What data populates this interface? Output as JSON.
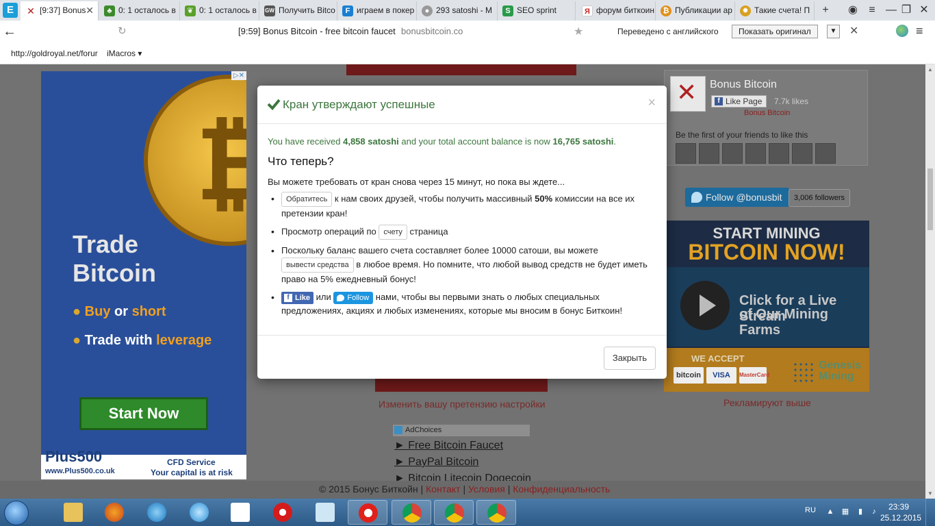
{
  "browser": {
    "tabs": [
      {
        "label": "[9:37] Bonus",
        "icon_color": "#ffffff",
        "icon": "bonus-bitcoin-icon",
        "active": true
      },
      {
        "label": "0: 1 осталось в",
        "icon_color": "#3c8a2a",
        "icon": "tree-icon"
      },
      {
        "label": "0: 1 осталось в",
        "icon_color": "#5aa02a",
        "icon": "leaf-icon"
      },
      {
        "label": "Получить Bitco",
        "icon_color": "#555555",
        "icon": "gw-icon"
      },
      {
        "label": "играем в покер",
        "icon_color": "#1a7fd0",
        "icon": "f-icon"
      },
      {
        "label": "293 satoshi - M",
        "icon_color": "#999999",
        "icon": "coin-icon"
      },
      {
        "label": "SEO sprint",
        "icon_color": "#2a9a4a",
        "icon": "seo-icon"
      },
      {
        "label": "форум биткоин",
        "icon_color": "#cc2a2a",
        "icon": "yandex-icon"
      },
      {
        "label": "Публикации ар",
        "icon_color": "#e0901a",
        "icon": "bitcoin-icon"
      },
      {
        "label": "Такие счета! П",
        "icon_color": "#d9a020",
        "icon": "gear-icon"
      }
    ],
    "new_tab": "+",
    "address": {
      "title": "[9:59] Bonus Bitcoin - free bitcoin faucet",
      "domain": "bonusbitcoin.co"
    },
    "translate": {
      "label": "Переведено с английского",
      "show_original": "Показать оригинал"
    },
    "bookmarks": [
      {
        "label": "http://goldroyal.net/forur"
      },
      {
        "label": "iMacros ▾"
      }
    ]
  },
  "left_ad": {
    "corner": "▷✕",
    "title_line1": "Trade",
    "title_line2": "Bitcoin",
    "bullet1_a": "Buy",
    "bullet1_b": "or",
    "bullet1_c": "short",
    "bullet2_a": "Trade with",
    "bullet2_b": "leverage",
    "cta": "Start Now",
    "brand": "Plus500",
    "brand_url": "www.Plus500.co.uk",
    "cfd": "CFD Service",
    "risk": "Your capital is at risk"
  },
  "center": {
    "change_link": "Изменить вашу претензию настройки",
    "adchoices": "AdChoices",
    "ad_links": [
      "► Free Bitcoin Faucet",
      "► PayPal Bitcoin",
      "► Bitcoin Litecoin Dogecoin"
    ]
  },
  "right": {
    "fb_name": "Bonus Bitcoin",
    "fb_like": "Like Page",
    "fb_likes": "7.7k likes",
    "fb_sub": "Bonus Bitcoin",
    "fb_friends": "Be the first of your friends to like this",
    "tw_follow": "Follow @bonusbit",
    "tw_followers": "3,006 followers",
    "mining_line1": "START MINING",
    "mining_line2": "BITCOIN NOW!",
    "live_line1": "Click for a Live Stream",
    "live_line2": "of Our Mining Farms",
    "we_accept": "WE ACCEPT",
    "pay_bitcoin": "bitcoin",
    "pay_visa": "VISA",
    "pay_mc": "MasterCard",
    "genesis1": "Genesis",
    "genesis2": "Mining",
    "advertise_above": "Рекламируют выше"
  },
  "footer": {
    "copyright": "© 2015 Бонус Биткойн |",
    "contact": "Контакт",
    "sep1": "|",
    "terms": "Условия",
    "sep2": "|",
    "privacy": "Конфиденциальность"
  },
  "modal": {
    "title": "Кран утверждают успешные",
    "close_x": "×",
    "received_pre": "You have received ",
    "received_amount": "4,858 satoshi",
    "received_mid": " and your total account balance is now ",
    "balance": "16,765 satoshi",
    "received_end": ".",
    "what_now": "Что теперь?",
    "intro": "Вы можете требовать от кран снова через 15 минут, но пока вы ждете...",
    "b1_btn": "Обратитесь",
    "b1_text_a": " к нам своих друзей, чтобы получить массивный ",
    "b1_bold": "50%",
    "b1_text_b": " комиссии на все их претензии кран!",
    "b2_text_a": "Просмотр операций по ",
    "b2_btn": "счету",
    "b2_text_b": " страница",
    "b3_text_a": "Поскольку баланс вашего счета составляет более 10000 сатоши, вы можете ",
    "b3_btn": "вывести средства",
    "b3_text_b": " в любое время. Но помните, что любой вывод средств не будет иметь право на 5% ежедневный бонус!",
    "b4_like": "Like",
    "b4_or": " или ",
    "b4_follow": "Follow",
    "b4_text": " нами, чтобы вы первыми знать о любых специальных предложениях, акциях и любых изменениях, которые мы вносим в бонус Биткоин!",
    "close_button": "Закрыть"
  },
  "taskbar": {
    "lang": "RU",
    "time": "23:39",
    "date": "25.12.2015"
  }
}
